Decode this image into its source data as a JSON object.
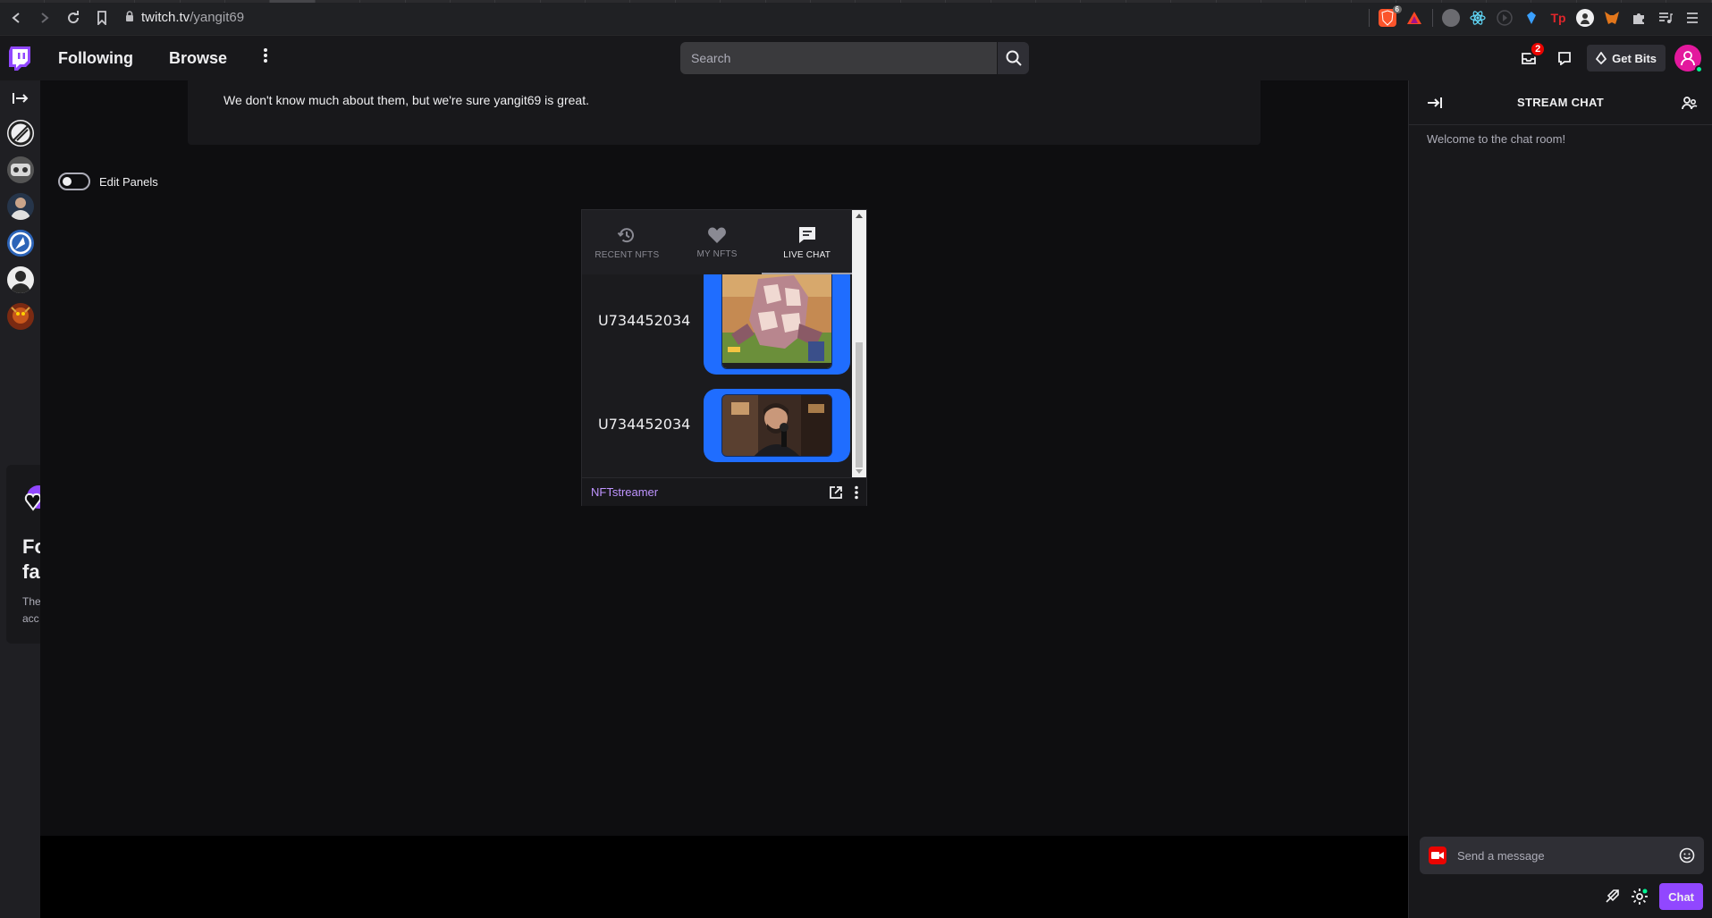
{
  "browser": {
    "url_host": "twitch.tv",
    "url_path": "/yangit69",
    "brave_shield_count": "6"
  },
  "topnav": {
    "following": "Following",
    "browse": "Browse",
    "search_placeholder": "Search",
    "notifications_count": "2",
    "get_bits": "Get Bits"
  },
  "about": {
    "text": "We don't know much about them, but we're sure yangit69 is great."
  },
  "edit_panels": {
    "label": "Edit Panels",
    "state": "off"
  },
  "promo": {
    "title_line1": "Fo",
    "title_line2": "fa",
    "text_line1": "The",
    "text_line2": "acc"
  },
  "extension": {
    "tabs": [
      {
        "label": "RECENT NFTS",
        "icon": "history-icon"
      },
      {
        "label": "MY NFTS",
        "icon": "heart-icon"
      },
      {
        "label": "LIVE CHAT",
        "icon": "chat-icon",
        "active": true
      }
    ],
    "feed": [
      {
        "user": "U734452034",
        "image": "robot-game-screenshot"
      },
      {
        "user": "U734452034",
        "image": "streamer-webcam"
      }
    ],
    "name": "NFTstreamer"
  },
  "chat": {
    "title": "STREAM CHAT",
    "welcome": "Welcome to the chat room!",
    "input_placeholder": "Send a message",
    "send_label": "Chat"
  },
  "colors": {
    "twitch_purple": "#9147ff",
    "nft_bubble_blue": "#1f6dff",
    "extension_link": "#bf94ff",
    "badge_red": "#eb0400",
    "background": "#0e0e10"
  }
}
